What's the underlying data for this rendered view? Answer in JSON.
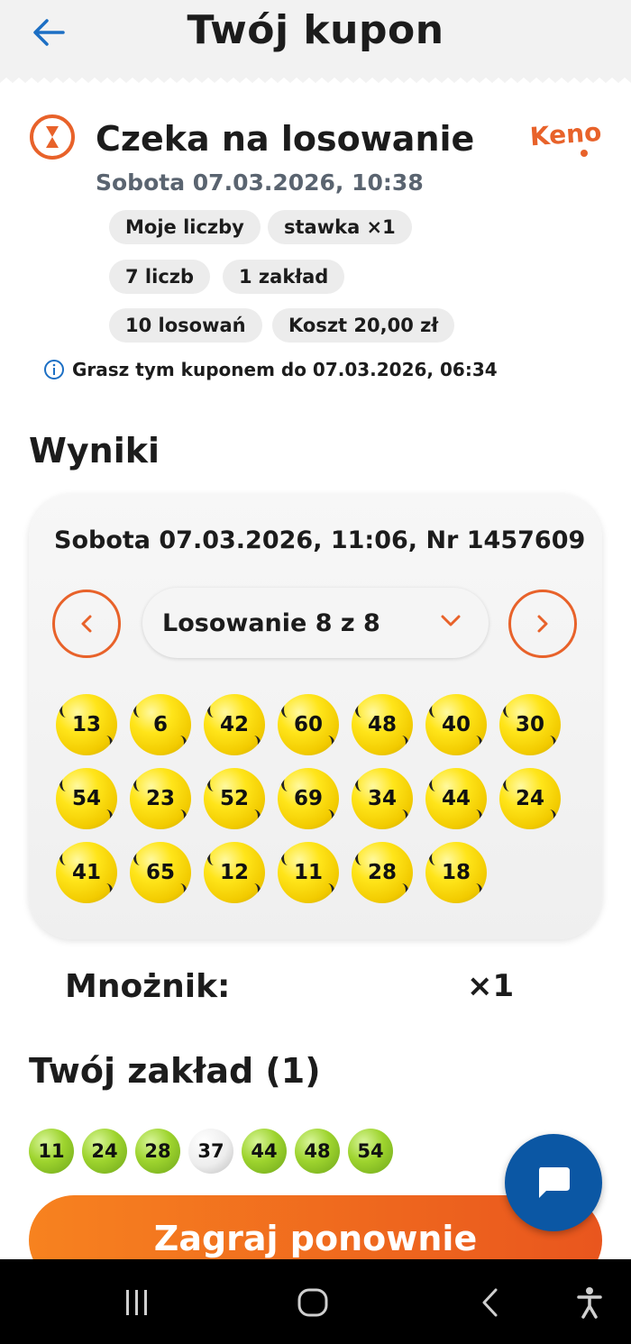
{
  "header": {
    "title": "Twój kupon"
  },
  "status": {
    "title": "Czeka na losowanie",
    "date": "Sobota 07.03.2026, 10:38",
    "logo_text": "KENO"
  },
  "chips": [
    "Moje liczby",
    "stawka ×1",
    "7 liczb",
    "1 zakład",
    "10 losowań",
    "Koszt 20,00 zł"
  ],
  "info": "Grasz tym kuponem do 07.03.2026, 06:34",
  "results": {
    "title": "Wyniki",
    "draw_info": "Sobota 07.03.2026, 11:06, Nr 1457609",
    "selector_label": "Losowanie 8 z 8",
    "balls": [
      "13",
      "6",
      "42",
      "60",
      "48",
      "40",
      "30",
      "54",
      "23",
      "52",
      "69",
      "34",
      "44",
      "24",
      "41",
      "65",
      "12",
      "11",
      "28",
      "18"
    ]
  },
  "multiplier": {
    "label": "Mnożnik:",
    "value": "×1"
  },
  "bet": {
    "title": "Twój zakład (1)",
    "numbers": [
      "11",
      "24",
      "28",
      "37",
      "44",
      "48",
      "54"
    ]
  },
  "actions": {
    "play_again": "Zagraj ponownie"
  },
  "colors": {
    "accent": "#e8622a",
    "brand_blue": "#0b57a4",
    "ball_yellow": "#ffe51a",
    "hit_green": "#9ed42e"
  }
}
